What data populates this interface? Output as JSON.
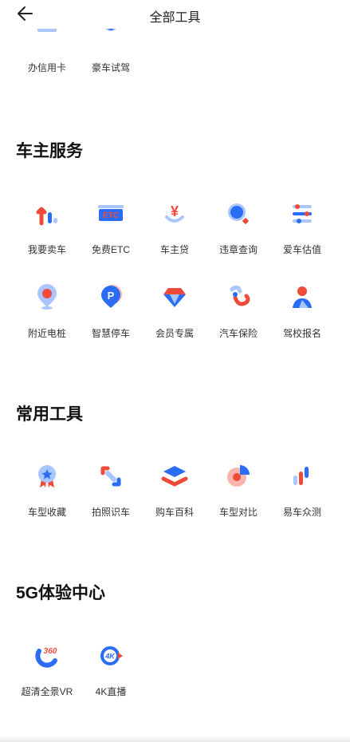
{
  "header": {
    "title": "全部工具"
  },
  "top_partial": {
    "items": [
      {
        "label": "办信用卡",
        "icon": "credit-card-icon"
      },
      {
        "label": "豪车试驾",
        "icon": "steering-wheel-icon"
      }
    ]
  },
  "sections": [
    {
      "title": "车主服务",
      "items": [
        {
          "label": "我要卖车",
          "icon": "sell-car-icon"
        },
        {
          "label": "免费ETC",
          "icon": "etc-icon",
          "badge": "ETC"
        },
        {
          "label": "车主贷",
          "icon": "yuan-loan-icon",
          "badge": "¥"
        },
        {
          "label": "违章查询",
          "icon": "magnifier-icon"
        },
        {
          "label": "爱车估值",
          "icon": "sliders-icon"
        },
        {
          "label": "附近电桩",
          "icon": "location-pin-icon"
        },
        {
          "label": "智慧停车",
          "icon": "parking-icon",
          "badge": "P"
        },
        {
          "label": "会员专属",
          "icon": "diamond-icon"
        },
        {
          "label": "汽车保险",
          "icon": "chain-link-icon"
        },
        {
          "label": "驾校报名",
          "icon": "driver-person-icon"
        }
      ]
    },
    {
      "title": "常用工具",
      "items": [
        {
          "label": "车型收藏",
          "icon": "star-medal-icon"
        },
        {
          "label": "拍照识车",
          "icon": "scan-icon"
        },
        {
          "label": "购车百科",
          "icon": "layers-icon"
        },
        {
          "label": "车型对比",
          "icon": "pie-chart-icon"
        },
        {
          "label": "易车众测",
          "icon": "test-bars-icon"
        }
      ]
    },
    {
      "title": "5G体验中心",
      "items": [
        {
          "label": "超清全景VR",
          "icon": "vr-360-icon",
          "badge": "360"
        },
        {
          "label": "4K直播",
          "icon": "live-4k-icon",
          "badge": "4K"
        }
      ]
    }
  ],
  "colors": {
    "blue": "#2b6cf6",
    "red": "#f04a3a",
    "light_blue": "#a9c6ff"
  }
}
